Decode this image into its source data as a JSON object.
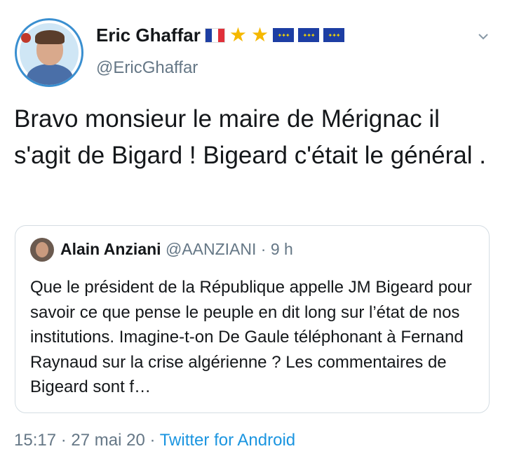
{
  "author": {
    "name": "Eric Ghaffar",
    "handle": "@EricGhaffar",
    "badges": [
      "fr-flag-icon",
      "star-icon",
      "star-icon",
      "eu-flag-icon",
      "eu-flag-icon",
      "eu-flag-icon"
    ]
  },
  "tweet": {
    "text": "Bravo monsieur le maire de Mérignac il s'agit de Bigard ! Bigeard c'était le général ."
  },
  "quoted": {
    "name": "Alain Anziani",
    "handle": "@AANZIANI",
    "time": "9 h",
    "text": "Que le président de la République appelle JM Bigeard pour savoir ce que pense le peuple en dit long sur l’état de nos institutions. Imagine-t-on De Gaule téléphonant à Fernand Raynaud sur la crise algérienne ? Les commentaires de Bigeard sont f…"
  },
  "meta": {
    "time": "15:17",
    "date": "27 mai 20",
    "source": "Twitter for Android"
  },
  "colors": {
    "link": "#1b95e0",
    "muted": "#657786",
    "border": "#d5dde3"
  }
}
